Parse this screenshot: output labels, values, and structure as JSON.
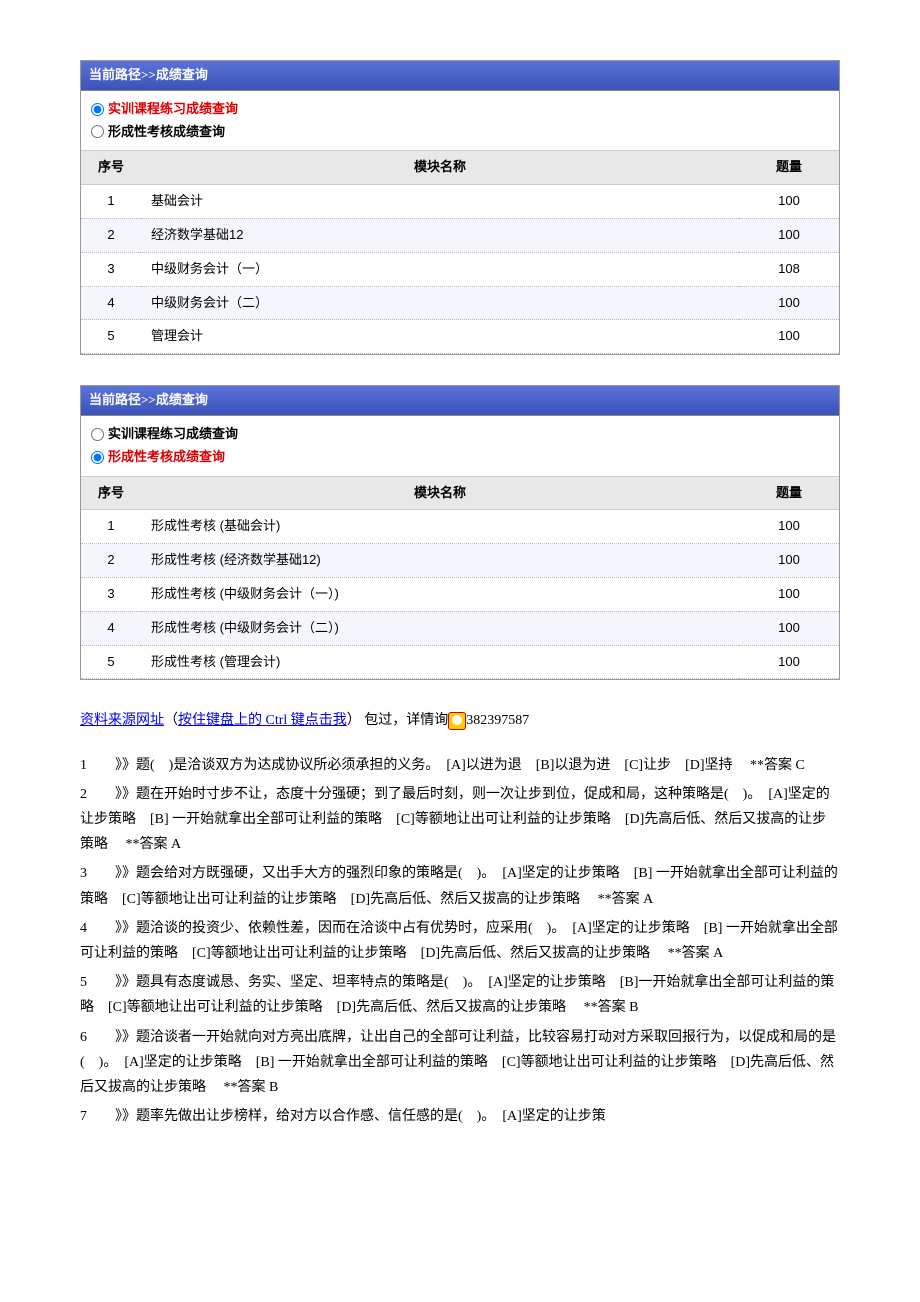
{
  "panel1": {
    "breadcrumb": "当前路径>>成绩查询",
    "radio1": "实训课程练习成绩查询",
    "radio2": "形成性考核成绩查询",
    "selected": 1,
    "headers": {
      "seq": "序号",
      "name": "模块名称",
      "qty": "题量"
    },
    "rows": [
      {
        "seq": "1",
        "name": "基础会计",
        "qty": "100"
      },
      {
        "seq": "2",
        "name": "经济数学基础12",
        "qty": "100"
      },
      {
        "seq": "3",
        "name": "中级财务会计（一）",
        "qty": "108"
      },
      {
        "seq": "4",
        "name": "中级财务会计（二）",
        "qty": "100"
      },
      {
        "seq": "5",
        "name": "管理会计",
        "qty": "100"
      }
    ]
  },
  "panel2": {
    "breadcrumb": "当前路径>>成绩查询",
    "radio1": "实训课程练习成绩查询",
    "radio2": "形成性考核成绩查询",
    "selected": 2,
    "headers": {
      "seq": "序号",
      "name": "模块名称",
      "qty": "题量"
    },
    "rows": [
      {
        "seq": "1",
        "name": "形成性考核 (基础会计)",
        "qty": "100"
      },
      {
        "seq": "2",
        "name": "形成性考核 (经济数学基础12)",
        "qty": "100"
      },
      {
        "seq": "3",
        "name": "形成性考核 (中级财务会计（一）)",
        "qty": "100"
      },
      {
        "seq": "4",
        "name": "形成性考核 (中级财务会计（二）)",
        "qty": "100"
      },
      {
        "seq": "5",
        "name": "形成性考核 (管理会计)",
        "qty": "100"
      }
    ]
  },
  "ref": {
    "link1": "资料来源网址",
    "paren_open": "（",
    "link2": "按住键盘上的 Ctrl 键点击我",
    "paren_close": "）",
    "text1": " 包过，详情询",
    "qq": "382397587"
  },
  "questions": [
    "1　　》》题(　)是洽谈双方为达成协议所必须承担的义务。　[A]以进为退　[B]以退为进　[C]让步　[D]坚持　 **答案 C",
    "2　　》》题在开始时寸步不让，态度十分强硬；到了最后时刻，则一次让步到位，促成和局，这种策略是(　)。　[A]坚定的让步策略　[B] 一开始就拿出全部可让利益的策略　[C]等额地让出可让利益的让步策略　[D]先高后低、然后又拔高的让步策略　 **答案 A",
    "3　　》》题会给对方既强硬，又出手大方的强烈印象的策略是(　)。　[A]坚定的让步策略　[B] 一开始就拿出全部可让利益的策略　[C]等额地让出可让利益的让步策略　[D]先高后低、然后又拔高的让步策略　 **答案 A",
    "4　　》》题洽谈的投资少、依赖性差，因而在洽谈中占有优势时，应采用(　)。　[A]坚定的让步策略　[B] 一开始就拿出全部可让利益的策略　[C]等额地让出可让利益的让步策略　[D]先高后低、然后又拔高的让步策略　 **答案 A",
    "5　　》》题具有态度诚恳、务实、坚定、坦率特点的策略是(　)。　[A]坚定的让步策略　[B]一开始就拿出全部可让利益的策略　[C]等额地让出可让利益的让步策略　[D]先高后低、然后又拔高的让步策略　 **答案 B",
    "6　　》》题洽谈者一开始就向对方亮出底牌，让出自己的全部可让利益，比较容易打动对方采取回报行为，以促成和局的是(　)。　[A]坚定的让步策略　[B] 一开始就拿出全部可让利益的策略　[C]等额地让出可让利益的让步策略　[D]先高后低、然后又拔高的让步策略　 **答案 B",
    "7　　》》题率先做出让步榜样，给对方以合作感、信任感的是(　)。　[A]坚定的让步策"
  ]
}
